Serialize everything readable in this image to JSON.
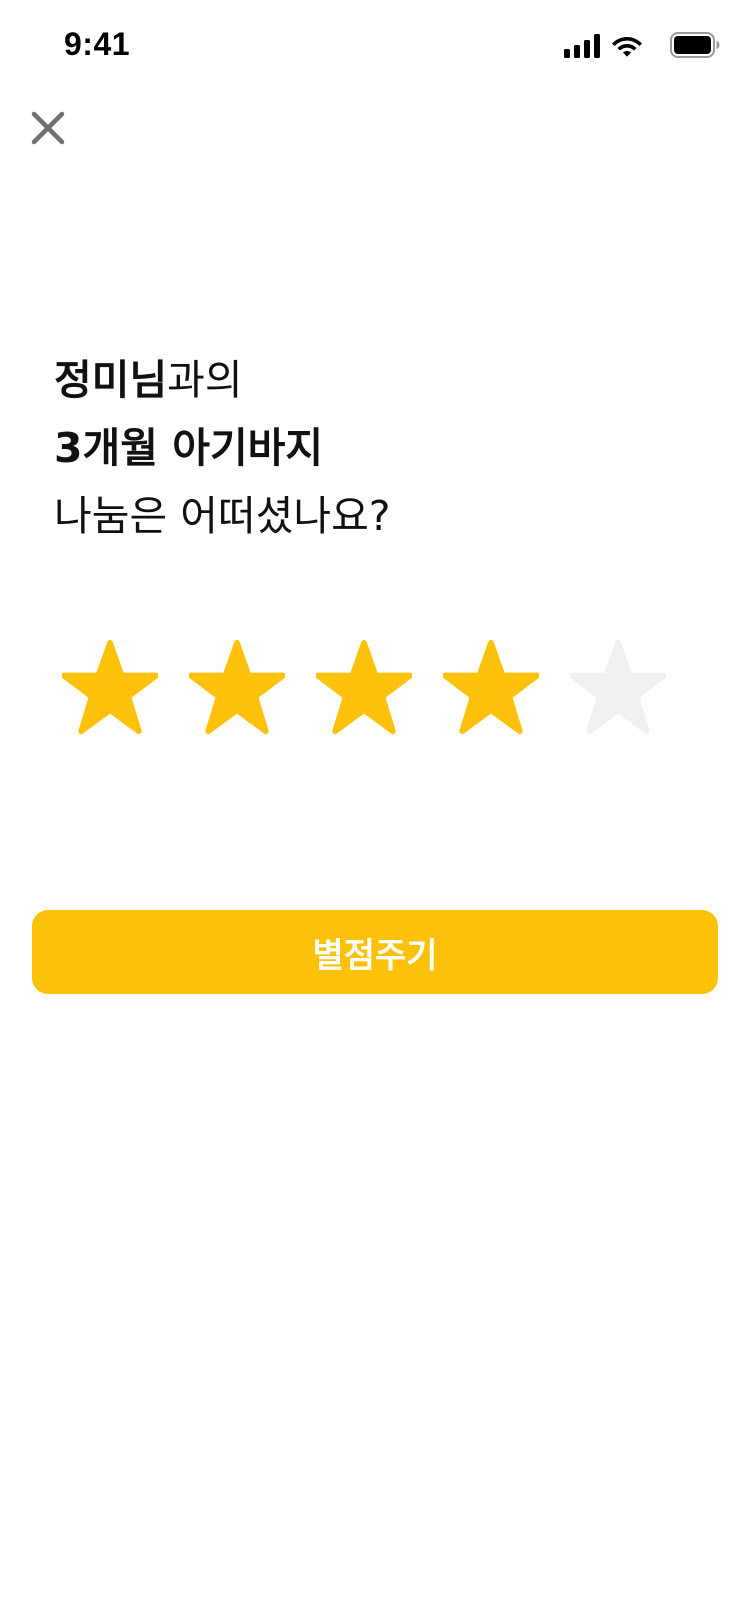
{
  "status_bar": {
    "time": "9:41",
    "icons": [
      "cellular-signal-icon",
      "wifi-icon",
      "battery-icon"
    ]
  },
  "header": {
    "close_icon": "close-icon"
  },
  "headline": {
    "partner_name": "정미님",
    "partner_suffix": "과의",
    "item_name": "3개월 아기바지",
    "question": "나눔은 어떠셨나요?"
  },
  "rating": {
    "value": 4,
    "max": 5,
    "filled_color": "#FDC10A",
    "empty_color": "#F1F1F1"
  },
  "submit": {
    "label": "별점주기",
    "color": "#FDC10A"
  }
}
